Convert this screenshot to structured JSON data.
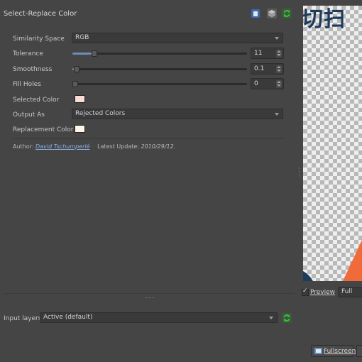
{
  "header": {
    "title": "Select-Replace Color"
  },
  "params": {
    "similarity_space": {
      "label": "Similarity Space",
      "value": "RGB"
    },
    "tolerance": {
      "label": "Tolerance",
      "value": "11",
      "fraction": 0.11
    },
    "smoothness": {
      "label": "Smoothness",
      "value": "0.1",
      "fraction": 0.01
    },
    "fill_holes": {
      "label": "Fill Holes",
      "value": "0",
      "fraction": 0.0
    },
    "selected_color": {
      "label": "Selected Color",
      "color": "#f8dcd6"
    },
    "output_as": {
      "label": "Output As",
      "value": "Rejected Colors"
    },
    "replacement_color": {
      "label": "Replacement Color",
      "color": "#fff6e8"
    }
  },
  "credits": {
    "author_label": "Author:",
    "author_name": "David Tschumperlé",
    "update_label": "Latest Update:",
    "update_date": "2010/29/12."
  },
  "input_layers": {
    "label": "Input layers",
    "value": "Active (default)"
  },
  "preview": {
    "checkbox_label": "Preview",
    "checked": true,
    "mode": "Full",
    "title_fragment": "切扫"
  },
  "buttons": {
    "fullscreen": "Fullscreen"
  },
  "colors": {
    "accent": "#6c8db8",
    "refresh": "#3cbf3c",
    "preview_orange": "#f06a3a",
    "preview_navy": "#1f3b5a"
  }
}
